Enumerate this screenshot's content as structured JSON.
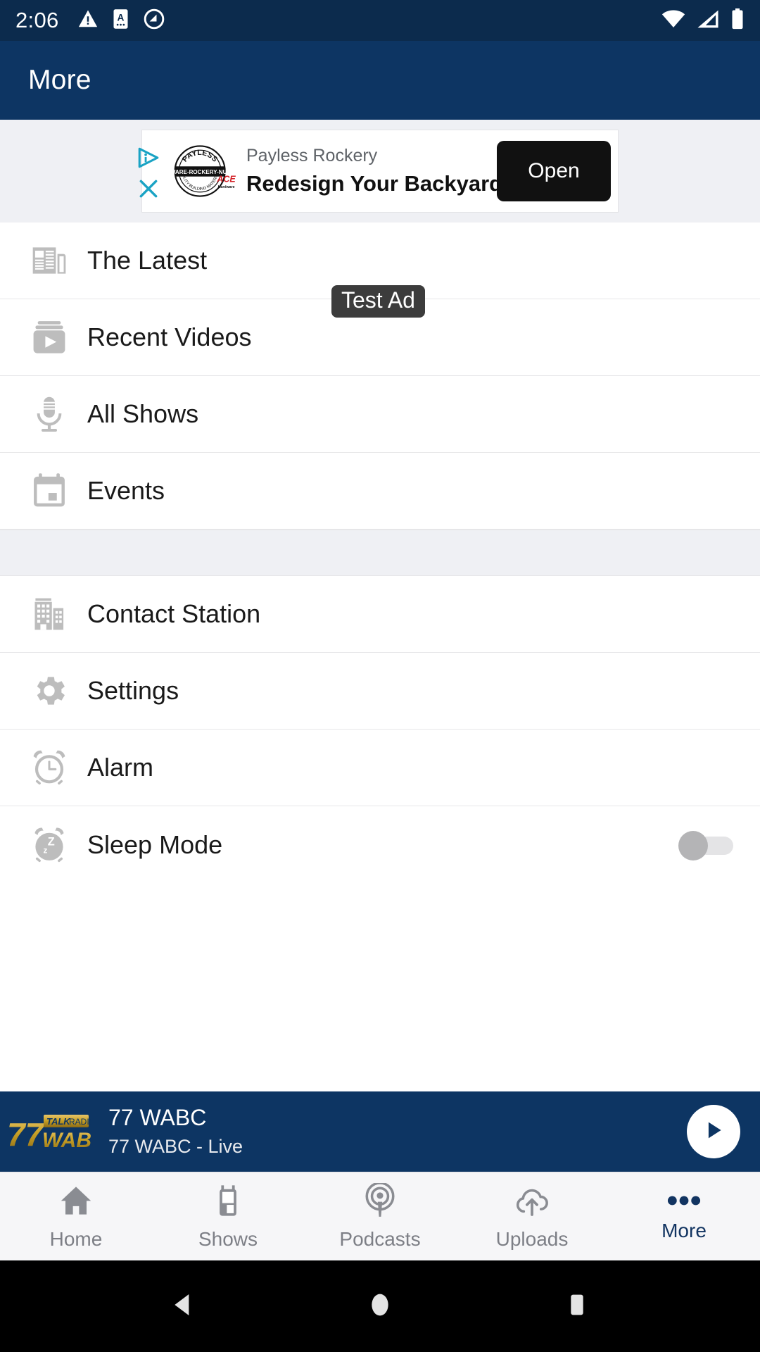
{
  "status_bar": {
    "time": "2:06",
    "left_icons": [
      "warning-triangle-icon",
      "a-badge-icon",
      "do-not-disturb-icon"
    ],
    "right_icons": [
      "wifi-icon",
      "cellular-signal-icon",
      "battery-icon"
    ],
    "background": "#0c2b4d"
  },
  "app_bar": {
    "title": "More",
    "background": "#0d3563"
  },
  "ad": {
    "badge_label": "Test Ad",
    "advertiser": "Payless Rockery",
    "headline": "Redesign Your Backyard",
    "cta_label": "Open",
    "adchoices_icon": "adchoices-icon",
    "close_icon": "close-x-icon",
    "logo": {
      "brand": "PAYLESS",
      "tagline": "HARDWARE-ROCKERY-NURSERY",
      "subtagline": "QUALITY BUILDING MATERIALS",
      "partner": "ACE",
      "partner_sub": "Hardware"
    },
    "background": "#eff0f4",
    "cta_background": "#111111"
  },
  "menu": {
    "group_one": [
      {
        "label": "The Latest",
        "icon": "newspaper-icon"
      },
      {
        "label": "Recent Videos",
        "icon": "video-library-icon"
      },
      {
        "label": "All Shows",
        "icon": "microphone-icon"
      },
      {
        "label": "Events",
        "icon": "calendar-icon"
      }
    ],
    "group_two": [
      {
        "label": "Contact Station",
        "icon": "building-icon"
      },
      {
        "label": "Settings",
        "icon": "gear-icon"
      },
      {
        "label": "Alarm",
        "icon": "alarm-clock-icon"
      }
    ],
    "sleep_mode": {
      "label": "Sleep Mode",
      "icon": "sleep-alarm-icon",
      "toggle_state": "off"
    }
  },
  "player": {
    "title": "77 WABC",
    "subtitle": "77 WABC - Live",
    "play_icon": "play-icon",
    "background": "#0d3563",
    "logo": {
      "number": "77",
      "talk": "TALK",
      "radio": "RADIO",
      "callsign": "WABC",
      "color": "#c9a227"
    }
  },
  "bottom_nav": {
    "active": "More",
    "active_color": "#123461",
    "inactive_color": "#7d7f86",
    "items": [
      {
        "label": "Home",
        "icon": "home-icon",
        "active": false
      },
      {
        "label": "Shows",
        "icon": "radio-tile-icon",
        "active": false
      },
      {
        "label": "Podcasts",
        "icon": "podcast-icon",
        "active": false
      },
      {
        "label": "Uploads",
        "icon": "cloud-upload-icon",
        "active": false
      },
      {
        "label": "More",
        "icon": "ellipsis-icon",
        "active": true
      }
    ]
  },
  "android_nav": {
    "back": "back-triangle-icon",
    "home": "home-circle-icon",
    "recents": "recents-square-icon"
  }
}
